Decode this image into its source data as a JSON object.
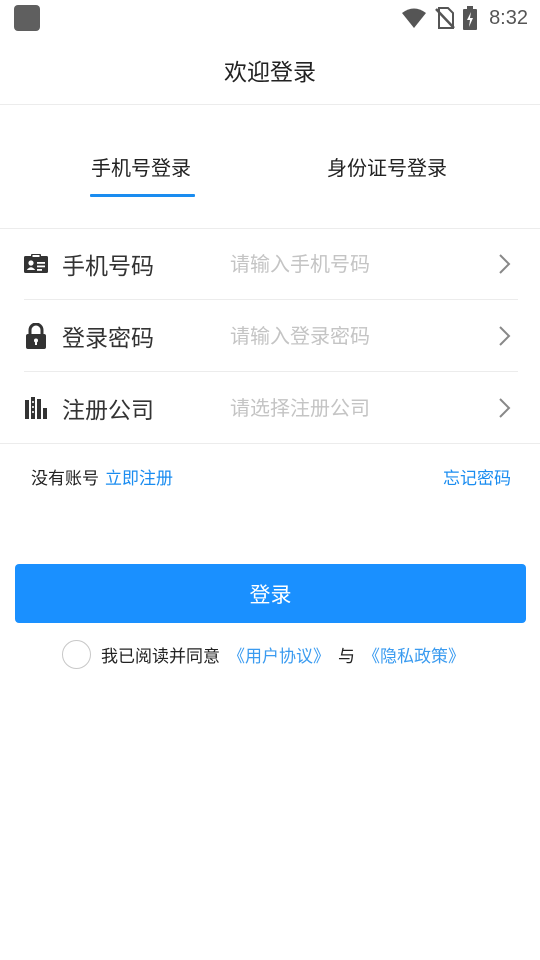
{
  "status_bar": {
    "time": "8:32"
  },
  "header": {
    "title": "欢迎登录"
  },
  "tabs": [
    {
      "label": "手机号登录",
      "active": true
    },
    {
      "label": "身份证号登录",
      "active": false
    }
  ],
  "form": {
    "rows": [
      {
        "label": "手机号码",
        "placeholder": "请输入手机号码",
        "icon": "id-card-icon"
      },
      {
        "label": "登录密码",
        "placeholder": "请输入登录密码",
        "icon": "lock-icon"
      },
      {
        "label": "注册公司",
        "placeholder": "请选择注册公司",
        "icon": "building-icon"
      }
    ]
  },
  "links": {
    "no_account": "没有账号",
    "register": "立即注册",
    "forgot": "忘记密码"
  },
  "login_button": {
    "label": "登录"
  },
  "agreement": {
    "text": "我已阅读并同意",
    "user_agreement": "《用户协议》",
    "and": "与",
    "privacy_policy": "《隐私政策》",
    "checked": false
  },
  "colors": {
    "accent": "#1a90ff",
    "link": "#1a8cf0"
  }
}
